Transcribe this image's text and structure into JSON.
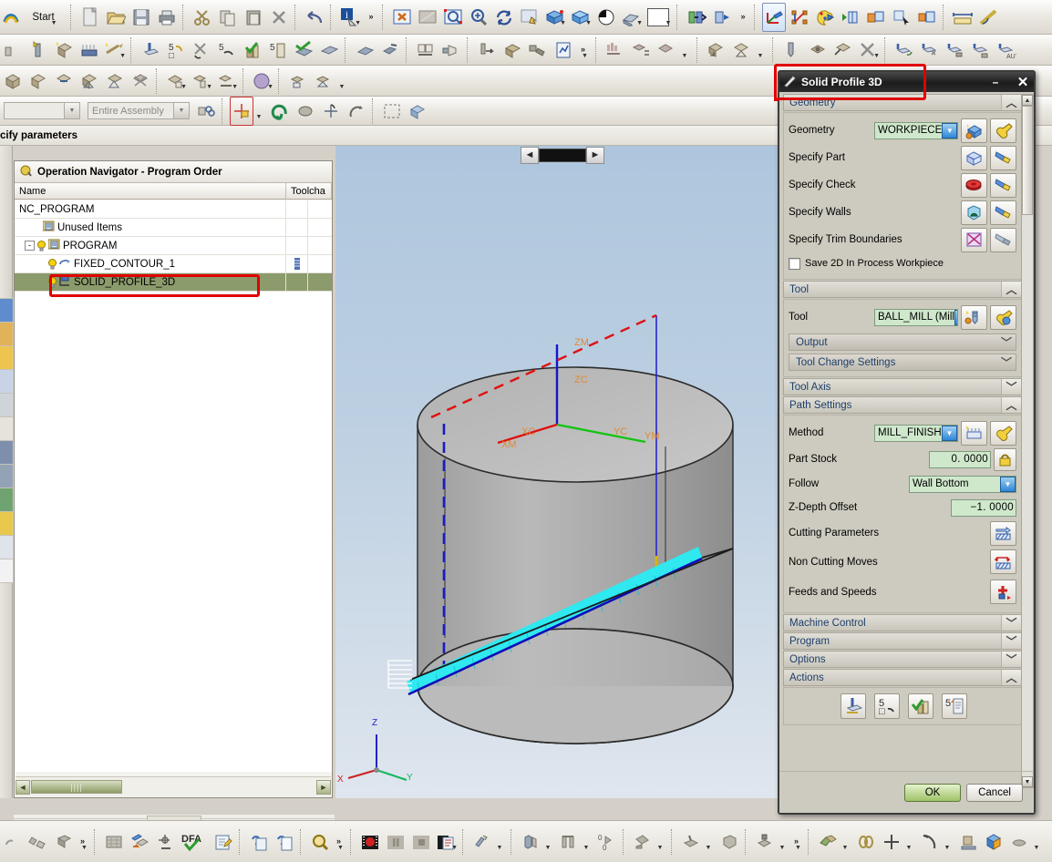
{
  "app": {
    "start_menu_label": "Start",
    "cue_text": "cify parameters",
    "assembly_filter_value": "Entire Assembly"
  },
  "navigator": {
    "title": "Operation Navigator - Program Order",
    "columns": [
      "Name",
      "Toolcha"
    ],
    "rows": [
      {
        "label": "NC_PROGRAM",
        "indent": 0,
        "icon": "none",
        "bulb": false,
        "expander": "",
        "selected": false,
        "toolchange": false
      },
      {
        "label": "Unused Items",
        "indent": 1,
        "icon": "program-folder-icon",
        "bulb": false,
        "expander": "",
        "selected": false,
        "toolchange": false
      },
      {
        "label": "PROGRAM",
        "indent": 1,
        "icon": "program-folder-icon",
        "bulb": true,
        "expander": "-",
        "selected": false,
        "toolchange": false
      },
      {
        "label": "FIXED_CONTOUR_1",
        "indent": 2,
        "icon": "fixed-contour-icon",
        "bulb": true,
        "expander": "",
        "selected": false,
        "toolchange": true
      },
      {
        "label": "SOLID_PROFILE_3D",
        "indent": 2,
        "icon": "solid-profile-icon",
        "bulb": true,
        "expander": "",
        "selected": true,
        "toolchange": false
      }
    ]
  },
  "viewport": {
    "csys_labels": [
      "ZM",
      "ZC",
      "YC",
      "YM",
      "XM",
      "XC"
    ],
    "triad_labels": [
      "Z",
      "Y",
      "X"
    ]
  },
  "dialog": {
    "title": "Solid Profile 3D",
    "minimize_label": "–",
    "close_label": "✕",
    "groups": {
      "geometry": {
        "header": "Geometry",
        "expanded": true,
        "geometry_label": "Geometry",
        "geometry_value": "WORKPIECE",
        "specify_part_label": "Specify Part",
        "specify_check_label": "Specify Check",
        "specify_walls_label": "Specify Walls",
        "specify_trim_label": "Specify Trim Boundaries",
        "save_2d_label": "Save 2D In Process Workpiece",
        "save_2d_checked": false
      },
      "tool": {
        "header": "Tool",
        "expanded": true,
        "tool_label": "Tool",
        "tool_value": "BALL_MILL (Mill",
        "output_label": "Output",
        "tool_change_label": "Tool Change Settings"
      },
      "tool_axis": {
        "header": "Tool Axis",
        "expanded": false
      },
      "path_settings": {
        "header": "Path Settings",
        "expanded": true,
        "method_label": "Method",
        "method_value": "MILL_FINISH",
        "part_stock_label": "Part Stock",
        "part_stock_value": "0. 0000",
        "follow_label": "Follow",
        "follow_value": "Wall Bottom",
        "z_depth_label": "Z-Depth Offset",
        "z_depth_value": "−1. 0000",
        "cutting_parameters_label": "Cutting Parameters",
        "non_cutting_moves_label": "Non Cutting Moves",
        "feeds_and_speeds_label": "Feeds and Speeds"
      },
      "machine_control": {
        "header": "Machine Control",
        "expanded": false
      },
      "program": {
        "header": "Program",
        "expanded": false
      },
      "options": {
        "header": "Options",
        "expanded": false
      },
      "actions": {
        "header": "Actions",
        "expanded": true
      }
    },
    "ok_label": "OK",
    "cancel_label": "Cancel"
  },
  "colors": {
    "dialog_bg": "#cdcabf",
    "field_green": "#cfe8cc",
    "group_header_text": "#1d3f6b",
    "selection_green": "#8b9b6b",
    "annotation_red": "#e00000",
    "ok_button": "#9ec267",
    "viewport_top": "#aec6dd",
    "toolpath_cyan": "#22e6ee",
    "toolpath_blue": "#0000cd"
  }
}
